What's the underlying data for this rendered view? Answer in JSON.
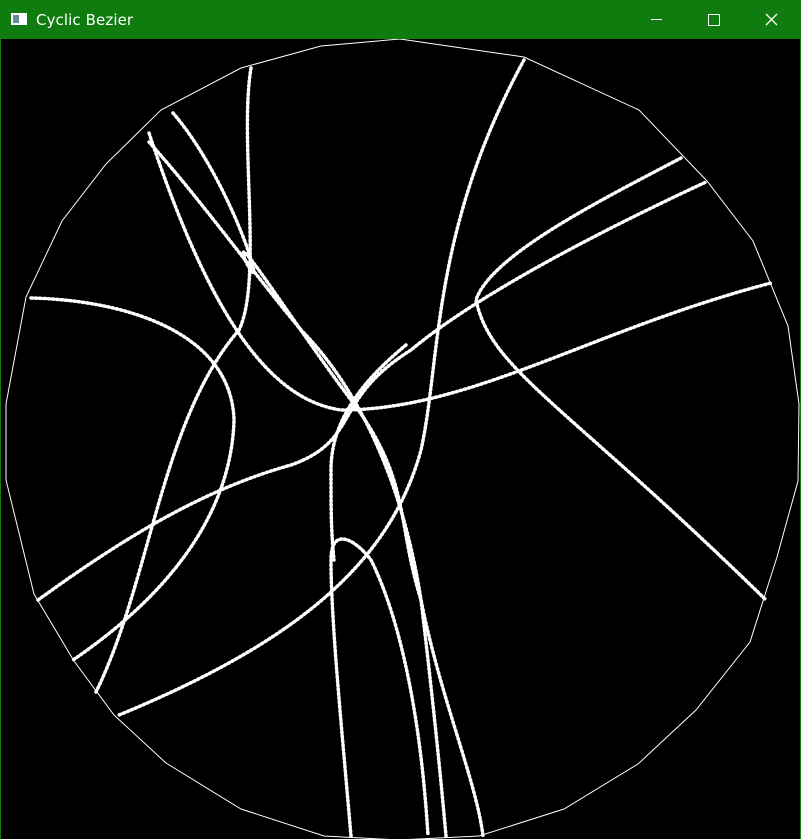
{
  "window": {
    "title": "Cyclic Bezier",
    "title_bar_color": "#107c10",
    "canvas_background": "#000000",
    "stroke_color": "#ffffff"
  },
  "controls": {
    "minimize_icon": "minimize-icon",
    "maximize_icon": "maximize-icon",
    "close_icon": "close-icon"
  }
}
